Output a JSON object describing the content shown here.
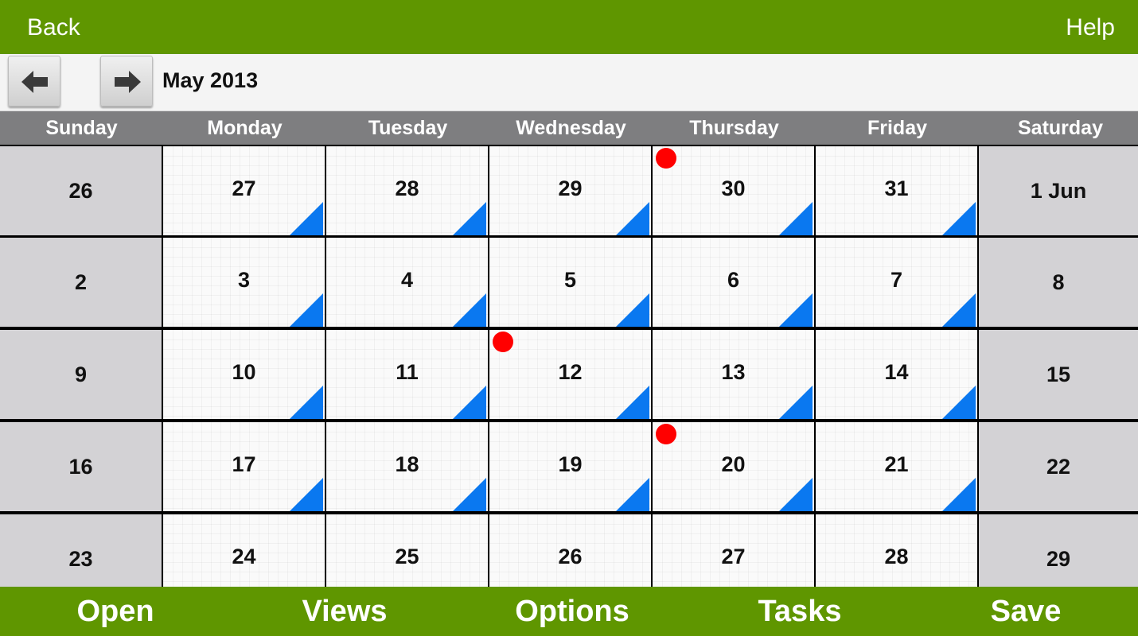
{
  "topbar": {
    "back_label": "Back",
    "help_label": "Help"
  },
  "navigation": {
    "month_label": "May 2013"
  },
  "weekdays": [
    "Sunday",
    "Monday",
    "Tuesday",
    "Wednesday",
    "Thursday",
    "Friday",
    "Saturday"
  ],
  "weeks": [
    [
      {
        "label": "26",
        "weekend": true
      },
      {
        "label": "27"
      },
      {
        "label": "28"
      },
      {
        "label": "29"
      },
      {
        "label": "30",
        "has_event": true
      },
      {
        "label": "31"
      },
      {
        "label": "1 Jun",
        "weekend": true
      }
    ],
    [
      {
        "label": "2",
        "weekend": true
      },
      {
        "label": "3"
      },
      {
        "label": "4"
      },
      {
        "label": "5"
      },
      {
        "label": "6"
      },
      {
        "label": "7"
      },
      {
        "label": "8",
        "weekend": true
      }
    ],
    [
      {
        "label": "9",
        "weekend": true
      },
      {
        "label": "10"
      },
      {
        "label": "11"
      },
      {
        "label": "12",
        "has_event": true
      },
      {
        "label": "13"
      },
      {
        "label": "14"
      },
      {
        "label": "15",
        "weekend": true
      }
    ],
    [
      {
        "label": "16",
        "weekend": true
      },
      {
        "label": "17"
      },
      {
        "label": "18"
      },
      {
        "label": "19"
      },
      {
        "label": "20",
        "has_event": true
      },
      {
        "label": "21"
      },
      {
        "label": "22",
        "weekend": true
      }
    ],
    [
      {
        "label": "23",
        "weekend": true
      },
      {
        "label": "24"
      },
      {
        "label": "25"
      },
      {
        "label": "26"
      },
      {
        "label": "27"
      },
      {
        "label": "28"
      },
      {
        "label": "29",
        "weekend": true
      }
    ]
  ],
  "bottombar": {
    "items": [
      "Open",
      "Views",
      "Options",
      "Tasks",
      "Save"
    ]
  },
  "colors": {
    "bar_green": "#5f9600",
    "header_gray": "#7e7e80",
    "weekend_gray": "#d3d2d5",
    "event_dot": "#ff0000",
    "corner_marker": "#0a78f0"
  }
}
